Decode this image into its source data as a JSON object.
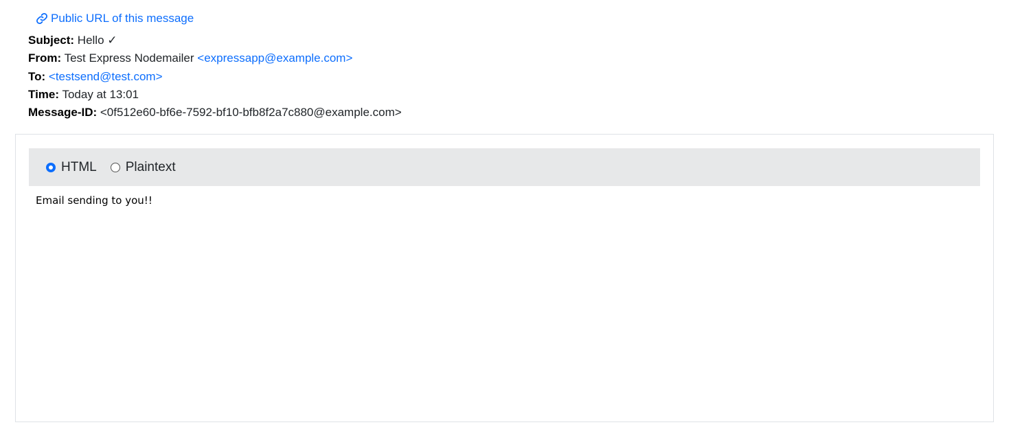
{
  "public_link": {
    "label": "Public URL of this message",
    "icon": "link-icon"
  },
  "headers": {
    "subject_key": "Subject:",
    "subject_value": "Hello ✓",
    "from_key": "From:",
    "from_name": "Test Express Nodemailer",
    "from_email": "<expressapp@example.com>",
    "to_key": "To:",
    "to_email": "<testsend@test.com>",
    "time_key": "Time:",
    "time_value": "Today at 13:01",
    "messageid_key": "Message-ID:",
    "messageid_value": "<0f512e60-bf6e-7592-bf10-bfb8f2a7c880@example.com>"
  },
  "view_options": {
    "html_label": "HTML",
    "plaintext_label": "Plaintext",
    "selected": "HTML"
  },
  "message_body": "Email sending to you!!",
  "colors": {
    "link": "#0d6efd",
    "toolbar_bg": "#e7e8e9",
    "border": "#dee2e6"
  }
}
